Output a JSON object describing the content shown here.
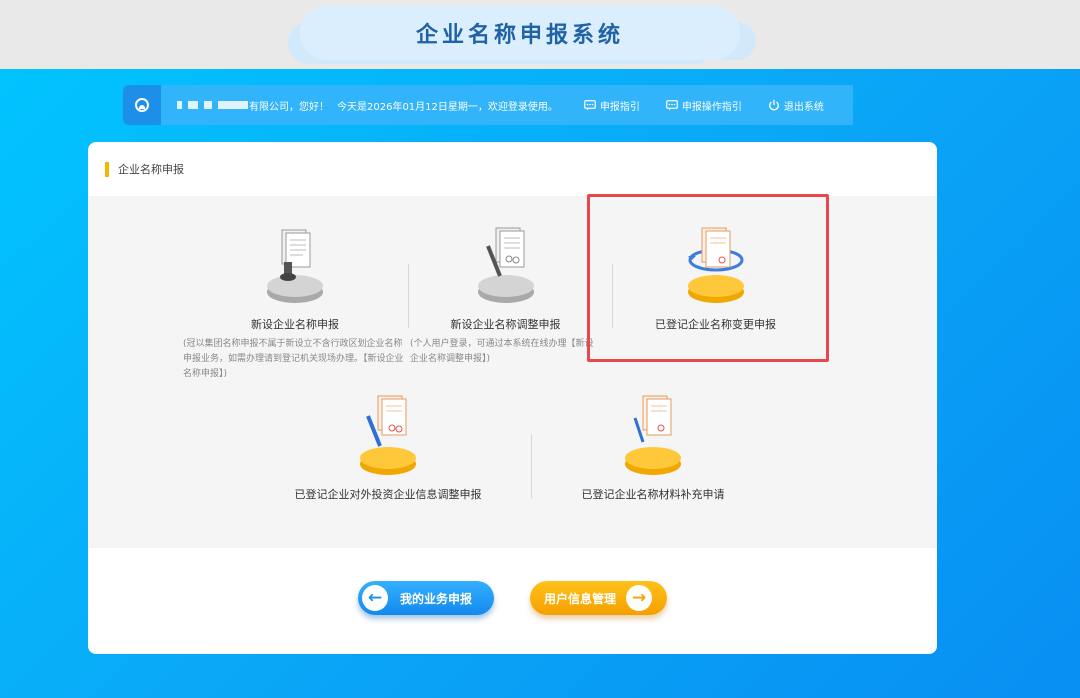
{
  "header": {
    "title": "企业名称申报系统"
  },
  "infobar": {
    "company_suffix": "有限公司，您好！",
    "greeting": "今天是2026年01月12日星期一，欢迎登录使用。",
    "links": [
      {
        "label": "申报指引",
        "icon": "message-icon"
      },
      {
        "label": "申报操作指引",
        "icon": "message-icon"
      },
      {
        "label": "退出系统",
        "icon": "power-icon"
      }
    ]
  },
  "panel": {
    "title": "企业名称申报",
    "tiles": [
      {
        "label": "新设企业名称申报",
        "desc": "(冠以集团名称申报不属于新设立不含行政区划企业名称申报业务，如需办理请到登记机关现场办理。【新设企业名称申报】)"
      },
      {
        "label": "新设企业名称调整申报",
        "desc": "(个人用户登录，可通过本系统在线办理【新设企业名称调整申报】)"
      },
      {
        "label": "已登记企业名称变更申报",
        "desc": ""
      },
      {
        "label": "已登记企业对外投资企业信息调整申报",
        "desc": ""
      },
      {
        "label": "已登记企业名称材料补充申请",
        "desc": ""
      }
    ]
  },
  "buttons": {
    "my_business": "我的业务申报",
    "user_info": "用户信息管理"
  },
  "colors": {
    "accent_blue": "#1389ee",
    "accent_orange": "#f5a000",
    "highlight_red": "#e8474d",
    "title_blue": "#1f62a6"
  }
}
